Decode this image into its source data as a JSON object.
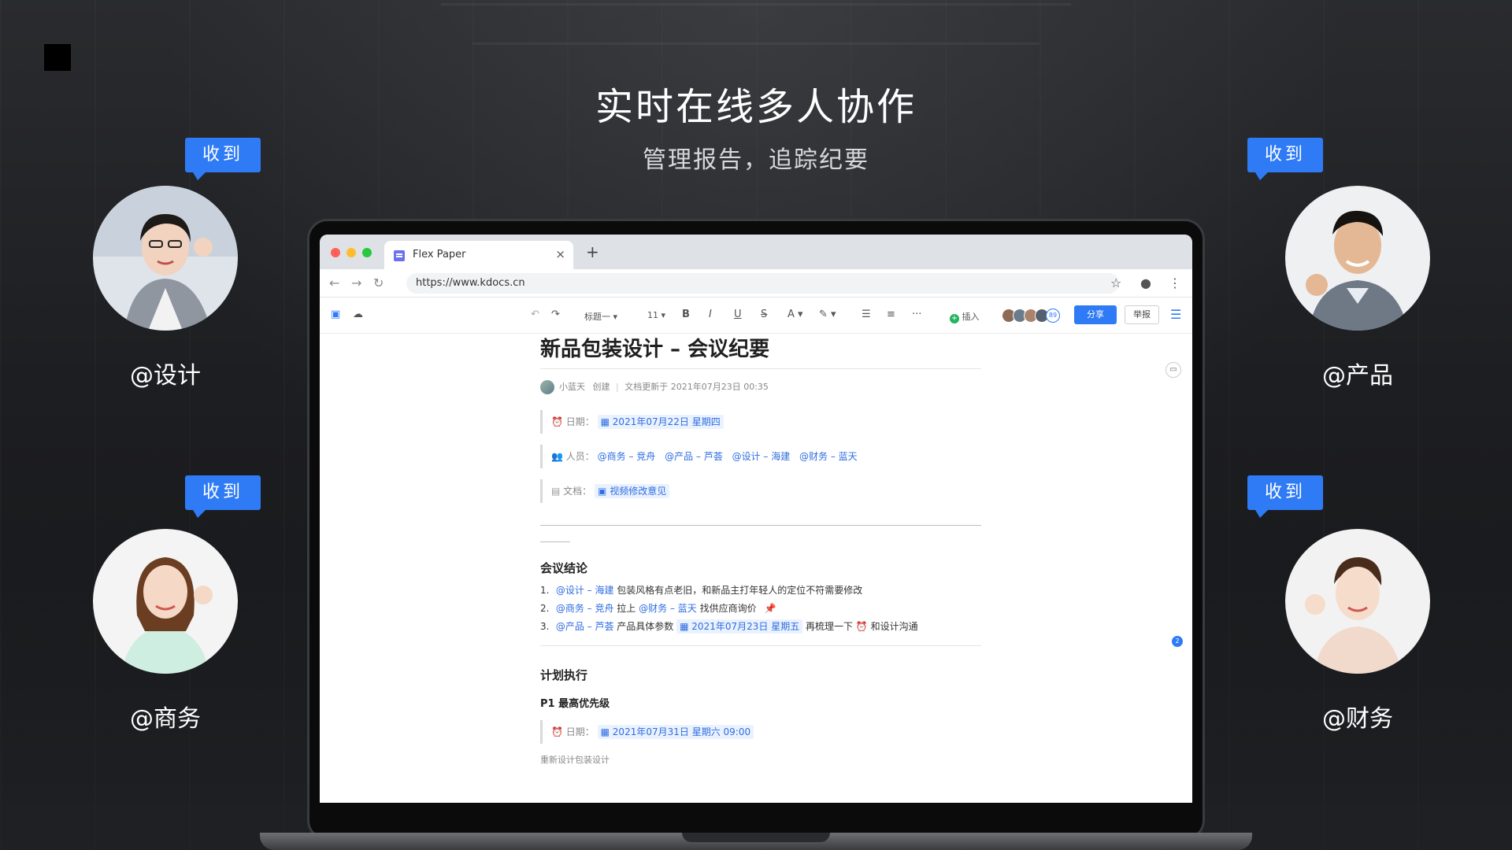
{
  "headline": "实时在线多人协作",
  "subline": "管理报告，追踪纪要",
  "people": [
    {
      "bubble": "收到",
      "handle": "@设计"
    },
    {
      "bubble": "收到",
      "handle": "@产品"
    },
    {
      "bubble": "收到",
      "handle": "@商务"
    },
    {
      "bubble": "收到",
      "handle": "@财务"
    }
  ],
  "browser": {
    "tab_title": "Flex Paper",
    "tab_close": "×",
    "new_tab": "+",
    "url": "https://www.kdocs.cn"
  },
  "toolbar": {
    "heading_select": "标题一 ▾",
    "font_size": "11 ▾",
    "bold": "B",
    "italic": "I",
    "underline": "U",
    "strike": "S",
    "font_color": "A ▾",
    "highlight": "✎ ▾",
    "more": "···",
    "insert": "插入",
    "avatar_count": "89",
    "share": "分享",
    "report": "举报"
  },
  "doc": {
    "title": "新品包装设计 – 会议纪要",
    "meta_author": "小蓝天",
    "meta_created": "创建",
    "meta_updated": "文档更新于 2021年07月23日 00:35",
    "date_label": "日期：",
    "date_value": "2021年07月22日 星期四",
    "people_label": "人员：",
    "people_values": [
      "@商务 – 竞舟",
      "@产品 – 芦荟",
      "@设计 – 海建",
      "@财务 – 蓝天"
    ],
    "docs_label": "文档：",
    "docs_value": "视频修改意见",
    "section1": "会议结论",
    "items": [
      {
        "num": "1.",
        "mention": "@设计 – 海建",
        "text": "包装风格有点老旧，和新品主打年轻人的定位不符需要修改"
      },
      {
        "num": "2.",
        "mention": "@商务 – 竞舟",
        "text_a": " 拉上",
        "mention2": "@财务 – 蓝天",
        "text_b": "找供应商询价"
      },
      {
        "num": "3.",
        "mention": "@产品 – 芦荟",
        "text_a": " 产品具体参数 ",
        "date": "2021年07月23日 星期五",
        "text_b": " 再梳理一下",
        "text_c": "和设计沟通"
      }
    ],
    "section2": "计划执行",
    "subsection": "P1 最高优先级",
    "p1_date_label": "日期：",
    "p1_date_value": "2021年07月31日 星期六 09:00",
    "cut_text": "重新设计包装设计",
    "side_badge": "2"
  },
  "colors": {
    "accent": "#2f7bf6",
    "mention": "#2f6de0",
    "tag_bg": "#eaf2ff"
  }
}
